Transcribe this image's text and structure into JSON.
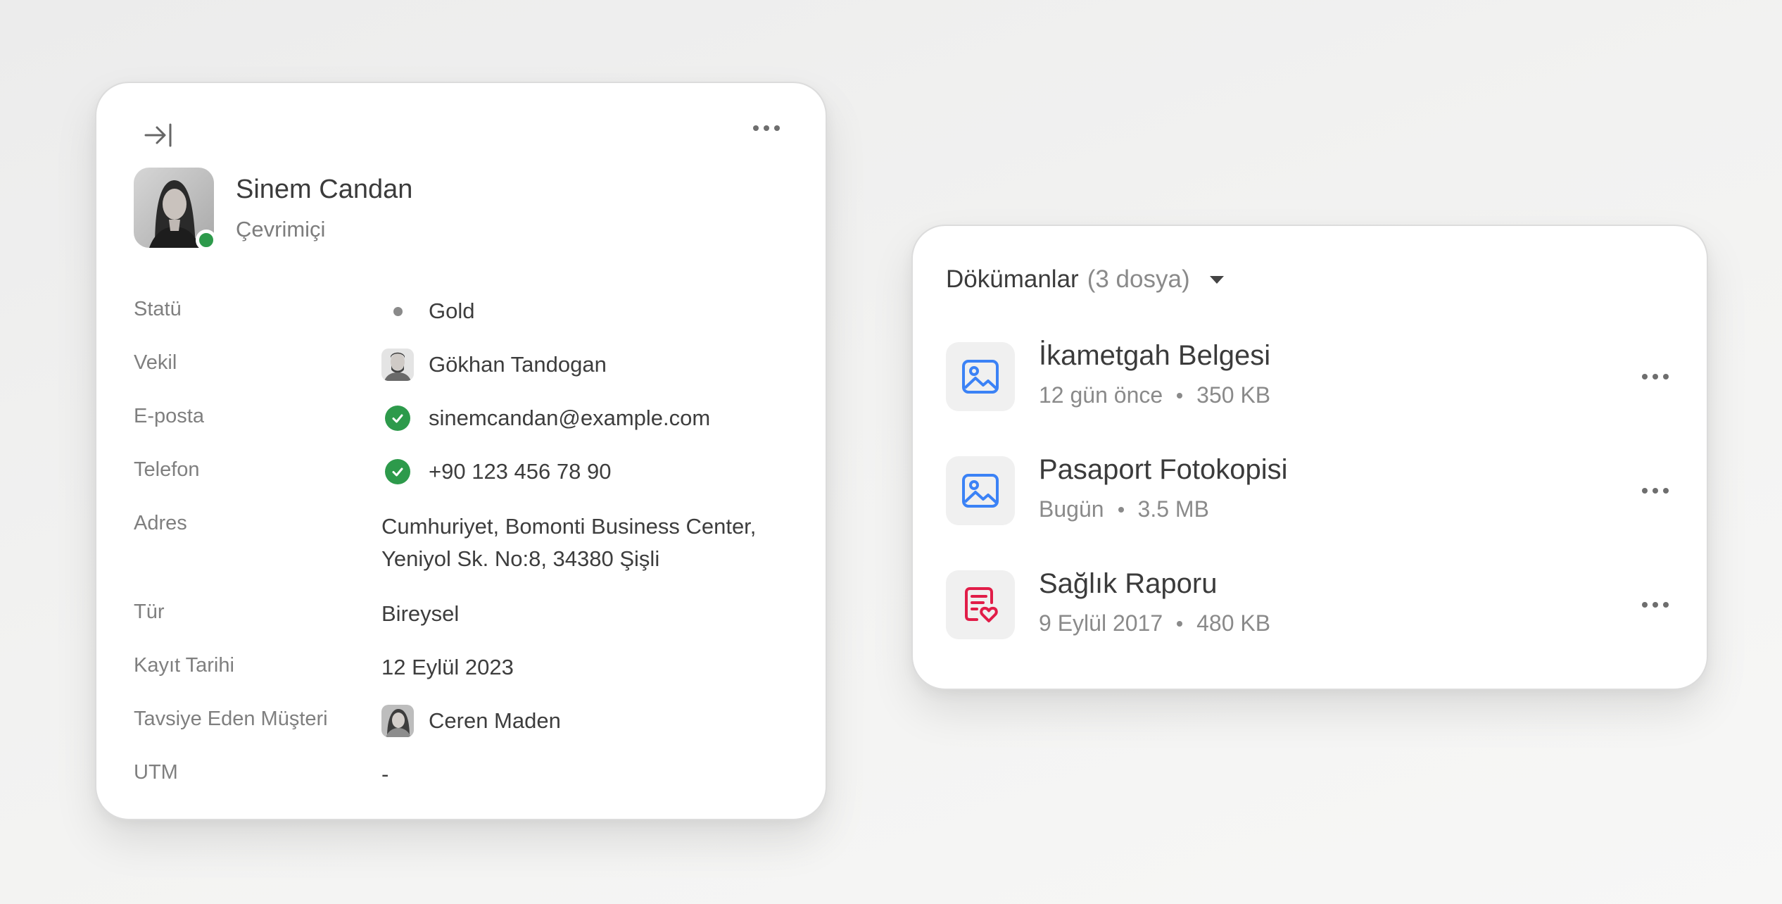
{
  "contact": {
    "name": "Sinem Candan",
    "presence": "Çevrimiçi",
    "presence_color": "#2d9a4b",
    "collapse_icon": "collapse-right-icon",
    "menu_icon": "more-horizontal-icon",
    "fields": {
      "status": {
        "label": "Statü",
        "value": "Gold"
      },
      "agent": {
        "label": "Vekil",
        "value": "Gökhan Tandogan"
      },
      "email": {
        "label": "E-posta",
        "value": "sinemcandan@example.com",
        "verified": true
      },
      "phone": {
        "label": "Telefon",
        "value": "+90 123 456 78 90",
        "verified": true
      },
      "address": {
        "label": "Adres",
        "line1": "Cumhuriyet, Bomonti Business Center,",
        "line2": "Yeniyol Sk. No:8, 34380 Şişli"
      },
      "type": {
        "label": "Tür",
        "value": "Bireysel"
      },
      "registered": {
        "label": "Kayıt Tarihi",
        "value": "12 Eylül 2023"
      },
      "referrer": {
        "label": "Tavsiye Eden Müşteri",
        "value": "Ceren Maden"
      },
      "utm": {
        "label": "UTM",
        "value": "-"
      }
    }
  },
  "documents": {
    "title": "Dökümanlar",
    "count": "(3 dosya)",
    "items": [
      {
        "name": "İkametgah Belgesi",
        "date": "12 gün önce",
        "size": "350 KB",
        "icon": "image-file-icon",
        "icon_color": "#3b82f6"
      },
      {
        "name": "Pasaport Fotokopisi",
        "date": "Bugün",
        "size": "3.5 MB",
        "icon": "image-file-icon",
        "icon_color": "#3b82f6"
      },
      {
        "name": "Sağlık Raporu",
        "date": "9 Eylül 2017",
        "size": "480 KB",
        "icon": "health-report-icon",
        "icon_color": "#e11d48"
      }
    ]
  },
  "colors": {
    "verified_green": "#2d9a4b",
    "accent_blue": "#3b82f6",
    "accent_red": "#e11d48"
  }
}
